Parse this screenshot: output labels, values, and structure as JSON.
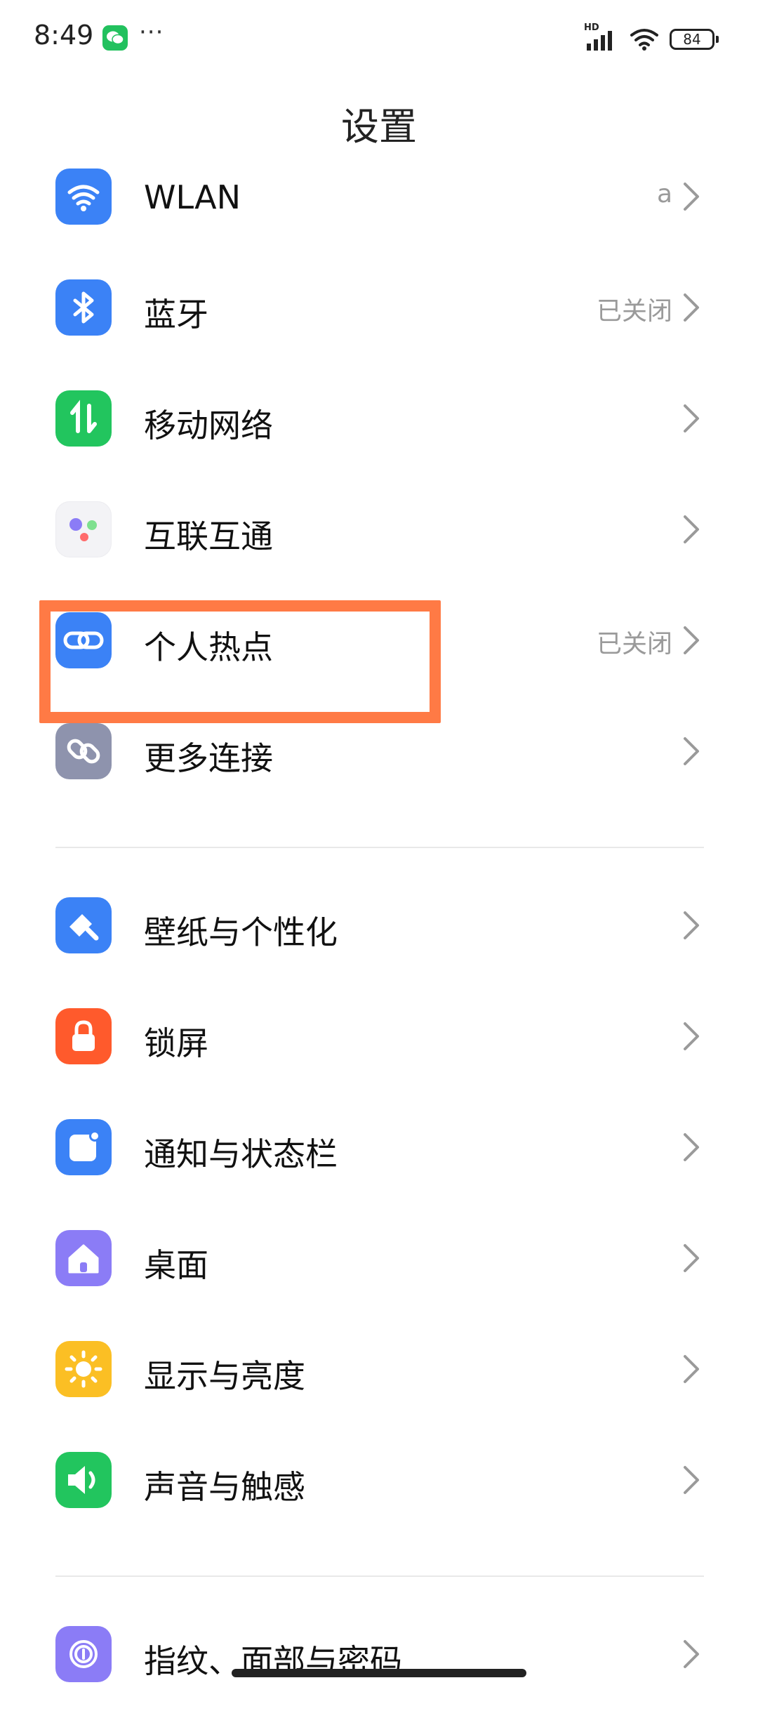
{
  "status_bar": {
    "time": "8:49",
    "more": "···",
    "network_badge": "HD",
    "battery": "84",
    "icons": [
      "wechat-icon",
      "signal-icon",
      "wifi-icon",
      "battery-icon"
    ]
  },
  "page": {
    "title": "设置"
  },
  "colors": {
    "wlan": "#3b82f6",
    "bluetooth": "#3b82f6",
    "mobile": "#22c55e",
    "interconnect": "#f3f3f6",
    "hotspot": "#3b82f6",
    "more": "#8e93ad",
    "wallpaper": "#3b82f6",
    "lock": "#ff5a2c",
    "notification": "#3b82f6",
    "desktop": "#8b7cf6",
    "display": "#fbbf24",
    "sound": "#22c55e",
    "fingerprint": "#8b7cf6",
    "highlight": "#ff7a45"
  },
  "settings": [
    {
      "id": "wlan",
      "label": "WLAN",
      "value": "a",
      "icon": "wifi-icon"
    },
    {
      "id": "bluetooth",
      "label": "蓝牙",
      "value": "已关闭",
      "icon": "bluetooth-icon"
    },
    {
      "id": "mobile-network",
      "label": "移动网络",
      "value": "",
      "icon": "mobile-data-icon"
    },
    {
      "id": "interconnect",
      "label": "互联互通",
      "value": "",
      "icon": "interconnect-dots-icon"
    },
    {
      "id": "hotspot",
      "label": "个人热点",
      "value": "已关闭",
      "icon": "link-icon"
    },
    {
      "id": "more-connections",
      "label": "更多连接",
      "value": "",
      "icon": "more-link-icon"
    },
    {
      "id": "wallpaper",
      "label": "壁纸与个性化",
      "value": "",
      "icon": "brush-icon"
    },
    {
      "id": "lock-screen",
      "label": "锁屏",
      "value": "",
      "icon": "lock-icon"
    },
    {
      "id": "notification",
      "label": "通知与状态栏",
      "value": "",
      "icon": "notification-icon"
    },
    {
      "id": "desktop",
      "label": "桌面",
      "value": "",
      "icon": "home-icon"
    },
    {
      "id": "display",
      "label": "显示与亮度",
      "value": "",
      "icon": "sun-icon"
    },
    {
      "id": "sound",
      "label": "声音与触感",
      "value": "",
      "icon": "speaker-icon"
    },
    {
      "id": "fingerprint",
      "label": "指纹、面部与密码",
      "value": "",
      "icon": "fingerprint-icon"
    }
  ]
}
